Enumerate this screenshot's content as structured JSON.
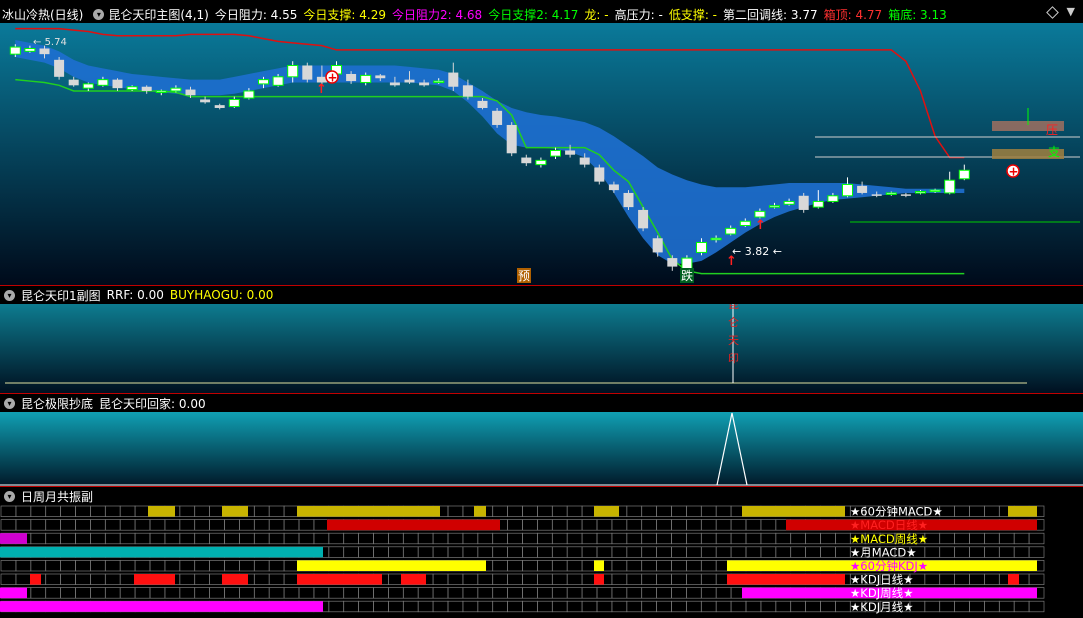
{
  "main_header": {
    "stock": "冰山冷热(日线)",
    "indicator": "昆仑天印主图(4,1)",
    "items": [
      {
        "label": "今日阻力: 4.55",
        "color": "#ffffff"
      },
      {
        "label": "今日支撑: 4.29",
        "color": "#ffff00"
      },
      {
        "label": "今日阻力2: 4.68",
        "color": "#ff00ff"
      },
      {
        "label": "今日支撑2: 4.17",
        "color": "#00ff00"
      },
      {
        "label": "龙: -",
        "color": "#ffff00"
      },
      {
        "label": "高压力: -",
        "color": "#ffffff"
      },
      {
        "label": "低支撑: -",
        "color": "#ffff00"
      },
      {
        "label": "第二回调线: 3.77",
        "color": "#ffffff"
      },
      {
        "label": "箱顶: 4.77",
        "color": "#ff3030"
      },
      {
        "label": "箱底: 3.13",
        "color": "#00ff00"
      }
    ]
  },
  "main_chart": {
    "labels": {
      "yu": "预",
      "die": "跌",
      "ya": "压",
      "zhi": "支",
      "low_label": "3.82",
      "high_label": "5.74"
    }
  },
  "sub1_header": {
    "name": "昆仑天印1副图",
    "rrf": "RRF: 0.00",
    "buy": "BUYHAOGU: 0.00"
  },
  "sub1_text": "昆仑天印",
  "sub2_header": {
    "name": "昆仑极限抄底",
    "value": "昆仑天印回家: 0.00"
  },
  "sub3_header": {
    "name": "日周月共振副"
  },
  "resonance_rows": [
    {
      "label": "★60分钟MACD★",
      "color": "#c8b400",
      "label_color": "#ffffff",
      "segments": [
        [
          148,
          175
        ],
        [
          222,
          248
        ],
        [
          297,
          440
        ],
        [
          474,
          486
        ],
        [
          594,
          619
        ],
        [
          742,
          845
        ],
        [
          1008,
          1037
        ]
      ]
    },
    {
      "label": "★MACD日线★",
      "color": "#d00000",
      "label_color": "#ff2020",
      "segments": [
        [
          327,
          500
        ],
        [
          786,
          1037
        ]
      ]
    },
    {
      "label": "★MACD周线★",
      "color": "#d000d0",
      "label_color": "#ffff00",
      "segments": [
        [
          0,
          27
        ]
      ]
    },
    {
      "label": "★月MACD★",
      "color": "#00b0b0",
      "label_color": "#ffffff",
      "segments": [
        [
          0,
          323
        ]
      ]
    },
    {
      "label": "★60分钟KDJ★",
      "color": "#ffff00",
      "label_color": "#ff00ff",
      "segments": [
        [
          297,
          486
        ],
        [
          594,
          604
        ],
        [
          727,
          1037
        ]
      ]
    },
    {
      "label": "★KDJ日线★",
      "color": "#ff1010",
      "label_color": "#ffffff",
      "segments": [
        [
          30,
          41
        ],
        [
          134,
          175
        ],
        [
          222,
          248
        ],
        [
          297,
          382
        ],
        [
          401,
          426
        ],
        [
          594,
          604
        ],
        [
          727,
          845
        ],
        [
          1008,
          1019
        ]
      ]
    },
    {
      "label": "★KDJ周线★",
      "color": "#ff00ff",
      "label_color": "#ffffff",
      "segments": [
        [
          0,
          27
        ],
        [
          742,
          1037
        ]
      ]
    },
    {
      "label": "★KDJ月线★",
      "color": "#ff00ff",
      "label_color": "#ffffff",
      "segments": [
        [
          0,
          323
        ]
      ]
    }
  ],
  "chart_data": {
    "type": "candlestick",
    "candles": [
      {
        "o": 4.78,
        "c": 4.83,
        "h": 4.85,
        "l": 4.76
      },
      {
        "o": 4.8,
        "c": 4.82,
        "h": 4.84,
        "l": 4.79
      },
      {
        "o": 4.82,
        "c": 4.78,
        "h": 4.84,
        "l": 4.75
      },
      {
        "o": 4.74,
        "c": 4.62,
        "h": 4.76,
        "l": 4.6
      },
      {
        "o": 4.6,
        "c": 4.56,
        "h": 4.62,
        "l": 4.55
      },
      {
        "o": 4.54,
        "c": 4.57,
        "h": 4.58,
        "l": 4.52
      },
      {
        "o": 4.56,
        "c": 4.6,
        "h": 4.62,
        "l": 4.55
      },
      {
        "o": 4.6,
        "c": 4.54,
        "h": 4.61,
        "l": 4.52
      },
      {
        "o": 4.53,
        "c": 4.55,
        "h": 4.56,
        "l": 4.52
      },
      {
        "o": 4.55,
        "c": 4.52,
        "h": 4.56,
        "l": 4.5
      },
      {
        "o": 4.51,
        "c": 4.52,
        "h": 4.53,
        "l": 4.49
      },
      {
        "o": 4.52,
        "c": 4.54,
        "h": 4.56,
        "l": 4.51
      },
      {
        "o": 4.53,
        "c": 4.49,
        "h": 4.55,
        "l": 4.47
      },
      {
        "o": 4.46,
        "c": 4.44,
        "h": 4.48,
        "l": 4.43
      },
      {
        "o": 4.42,
        "c": 4.4,
        "h": 4.43,
        "l": 4.39
      },
      {
        "o": 4.41,
        "c": 4.46,
        "h": 4.48,
        "l": 4.4
      },
      {
        "o": 4.47,
        "c": 4.52,
        "h": 4.54,
        "l": 4.46
      },
      {
        "o": 4.57,
        "c": 4.6,
        "h": 4.62,
        "l": 4.54
      },
      {
        "o": 4.56,
        "c": 4.62,
        "h": 4.64,
        "l": 4.55
      },
      {
        "o": 4.62,
        "c": 4.7,
        "h": 4.73,
        "l": 4.58
      },
      {
        "o": 4.7,
        "c": 4.6,
        "h": 4.72,
        "l": 4.58
      },
      {
        "o": 4.62,
        "c": 4.58,
        "h": 4.7,
        "l": 4.56
      },
      {
        "o": 4.64,
        "c": 4.7,
        "h": 4.73,
        "l": 4.63
      },
      {
        "o": 4.64,
        "c": 4.59,
        "h": 4.66,
        "l": 4.57
      },
      {
        "o": 4.58,
        "c": 4.63,
        "h": 4.65,
        "l": 4.56
      },
      {
        "o": 4.63,
        "c": 4.61,
        "h": 4.64,
        "l": 4.59
      },
      {
        "o": 4.58,
        "c": 4.56,
        "h": 4.62,
        "l": 4.55
      },
      {
        "o": 4.6,
        "c": 4.58,
        "h": 4.66,
        "l": 4.57
      },
      {
        "o": 4.58,
        "c": 4.56,
        "h": 4.6,
        "l": 4.55
      },
      {
        "o": 4.58,
        "c": 4.59,
        "h": 4.61,
        "l": 4.57
      },
      {
        "o": 4.65,
        "c": 4.55,
        "h": 4.72,
        "l": 4.52
      },
      {
        "o": 4.56,
        "c": 4.48,
        "h": 4.6,
        "l": 4.46
      },
      {
        "o": 4.45,
        "c": 4.4,
        "h": 4.47,
        "l": 4.39
      },
      {
        "o": 4.38,
        "c": 4.28,
        "h": 4.4,
        "l": 4.26
      },
      {
        "o": 4.28,
        "c": 4.08,
        "h": 4.3,
        "l": 4.06
      },
      {
        "o": 4.05,
        "c": 4.01,
        "h": 4.07,
        "l": 3.99
      },
      {
        "o": 4.0,
        "c": 4.03,
        "h": 4.05,
        "l": 3.98
      },
      {
        "o": 4.06,
        "c": 4.1,
        "h": 4.12,
        "l": 4.04
      },
      {
        "o": 4.1,
        "c": 4.07,
        "h": 4.14,
        "l": 4.05
      },
      {
        "o": 4.05,
        "c": 4.0,
        "h": 4.08,
        "l": 3.98
      },
      {
        "o": 3.98,
        "c": 3.88,
        "h": 4.0,
        "l": 3.86
      },
      {
        "o": 3.86,
        "c": 3.82,
        "h": 3.88,
        "l": 3.8
      },
      {
        "o": 3.8,
        "c": 3.7,
        "h": 3.82,
        "l": 3.68
      },
      {
        "o": 3.68,
        "c": 3.55,
        "h": 3.7,
        "l": 3.53
      },
      {
        "o": 3.48,
        "c": 3.38,
        "h": 3.5,
        "l": 3.35
      },
      {
        "o": 3.34,
        "c": 3.28,
        "h": 3.36,
        "l": 3.25
      },
      {
        "o": 3.26,
        "c": 3.34,
        "h": 3.36,
        "l": 3.22
      },
      {
        "o": 3.38,
        "c": 3.45,
        "h": 3.48,
        "l": 3.36
      },
      {
        "o": 3.47,
        "c": 3.48,
        "h": 3.5,
        "l": 3.45
      },
      {
        "o": 3.51,
        "c": 3.55,
        "h": 3.57,
        "l": 3.5
      },
      {
        "o": 3.57,
        "c": 3.6,
        "h": 3.62,
        "l": 3.56
      },
      {
        "o": 3.63,
        "c": 3.67,
        "h": 3.69,
        "l": 3.62
      },
      {
        "o": 3.7,
        "c": 3.71,
        "h": 3.73,
        "l": 3.69
      },
      {
        "o": 3.72,
        "c": 3.74,
        "h": 3.76,
        "l": 3.71
      },
      {
        "o": 3.78,
        "c": 3.68,
        "h": 3.8,
        "l": 3.66
      },
      {
        "o": 3.7,
        "c": 3.74,
        "h": 3.82,
        "l": 3.69
      },
      {
        "o": 3.74,
        "c": 3.78,
        "h": 3.8,
        "l": 3.73
      },
      {
        "o": 3.78,
        "c": 3.86,
        "h": 3.91,
        "l": 3.77
      },
      {
        "o": 3.85,
        "c": 3.8,
        "h": 3.88,
        "l": 3.79
      },
      {
        "o": 3.79,
        "c": 3.78,
        "h": 3.81,
        "l": 3.77
      },
      {
        "o": 3.79,
        "c": 3.8,
        "h": 3.81,
        "l": 3.78
      },
      {
        "o": 3.79,
        "c": 3.78,
        "h": 3.8,
        "l": 3.77
      },
      {
        "o": 3.8,
        "c": 3.81,
        "h": 3.82,
        "l": 3.79
      },
      {
        "o": 3.81,
        "c": 3.82,
        "h": 3.83,
        "l": 3.8
      },
      {
        "o": 3.8,
        "c": 3.89,
        "h": 3.95,
        "l": 3.79
      },
      {
        "o": 3.9,
        "c": 3.96,
        "h": 4.0,
        "l": 3.89
      }
    ],
    "lines": {
      "resistance_red": [
        4.96,
        4.96,
        4.96,
        4.96,
        4.95,
        4.94,
        4.92,
        4.91,
        4.91,
        4.91,
        4.91,
        4.91,
        4.92,
        4.92,
        4.92,
        4.92,
        4.91,
        4.89,
        4.87,
        4.86,
        4.85,
        4.84,
        4.81,
        4.81,
        4.81,
        4.81,
        4.81,
        4.81,
        4.81,
        4.81,
        4.81,
        4.81,
        4.81,
        4.81,
        4.81,
        4.81,
        4.81,
        4.81,
        4.81,
        4.81,
        4.81,
        4.81,
        4.81,
        4.81,
        4.81,
        4.81,
        4.81,
        4.81,
        4.81,
        4.81,
        4.81,
        4.81,
        4.81,
        4.81,
        4.81,
        4.81,
        4.81,
        4.81,
        4.81,
        4.81,
        4.81,
        4.73,
        4.52,
        4.2,
        4.05,
        4.05
      ],
      "support_green": [
        4.6,
        4.59,
        4.58,
        4.56,
        4.52,
        4.52,
        4.52,
        4.52,
        4.52,
        4.52,
        4.52,
        4.51,
        4.48,
        4.48,
        4.48,
        4.48,
        4.48,
        4.48,
        4.48,
        4.48,
        4.48,
        4.48,
        4.48,
        4.48,
        4.48,
        4.48,
        4.48,
        4.48,
        4.48,
        4.48,
        4.48,
        4.48,
        4.48,
        4.45,
        4.35,
        4.12,
        4.12,
        4.12,
        4.12,
        4.12,
        4.07,
        3.96,
        3.88,
        3.7,
        3.52,
        3.33,
        3.25,
        3.23,
        3.23,
        3.23,
        3.23,
        3.23,
        3.23,
        3.23,
        3.23,
        3.23,
        3.23,
        3.23,
        3.23,
        3.23,
        3.23,
        3.23,
        3.23,
        3.23,
        3.23,
        3.23
      ]
    },
    "band_upper": [
      4.88,
      4.86,
      4.84,
      4.8,
      4.74,
      4.7,
      4.68,
      4.66,
      4.64,
      4.63,
      4.62,
      4.61,
      4.6,
      4.6,
      4.6,
      4.62,
      4.64,
      4.66,
      4.68,
      4.7,
      4.7,
      4.7,
      4.7,
      4.7,
      4.7,
      4.7,
      4.7,
      4.69,
      4.68,
      4.67,
      4.64,
      4.58,
      4.52,
      4.45,
      4.4,
      4.37,
      4.35,
      4.34,
      4.32,
      4.3,
      4.26,
      4.2,
      4.13,
      4.06,
      3.98,
      3.93,
      3.89,
      3.86,
      3.84,
      3.84,
      3.84,
      3.85,
      3.86,
      3.87,
      3.87,
      3.87,
      3.87,
      3.87,
      3.86,
      3.85,
      3.84,
      3.83,
      3.83,
      3.83,
      3.83,
      3.83
    ],
    "band_lower": [
      4.76,
      4.74,
      4.72,
      4.68,
      4.62,
      4.58,
      4.56,
      4.55,
      4.53,
      4.52,
      4.51,
      4.5,
      4.49,
      4.49,
      4.49,
      4.5,
      4.52,
      4.54,
      4.56,
      4.58,
      4.58,
      4.58,
      4.58,
      4.58,
      4.58,
      4.58,
      4.58,
      4.58,
      4.57,
      4.56,
      4.52,
      4.44,
      4.34,
      4.22,
      4.14,
      4.12,
      4.12,
      4.11,
      4.09,
      4.05,
      3.95,
      3.8,
      3.63,
      3.48,
      3.36,
      3.3,
      3.3,
      3.32,
      3.38,
      3.45,
      3.52,
      3.58,
      3.63,
      3.67,
      3.7,
      3.73,
      3.75,
      3.76,
      3.77,
      3.78,
      3.79,
      3.8,
      3.8,
      3.8,
      3.8,
      3.8
    ],
    "sub1_value": 0.0,
    "sub2_value": 0.0
  }
}
